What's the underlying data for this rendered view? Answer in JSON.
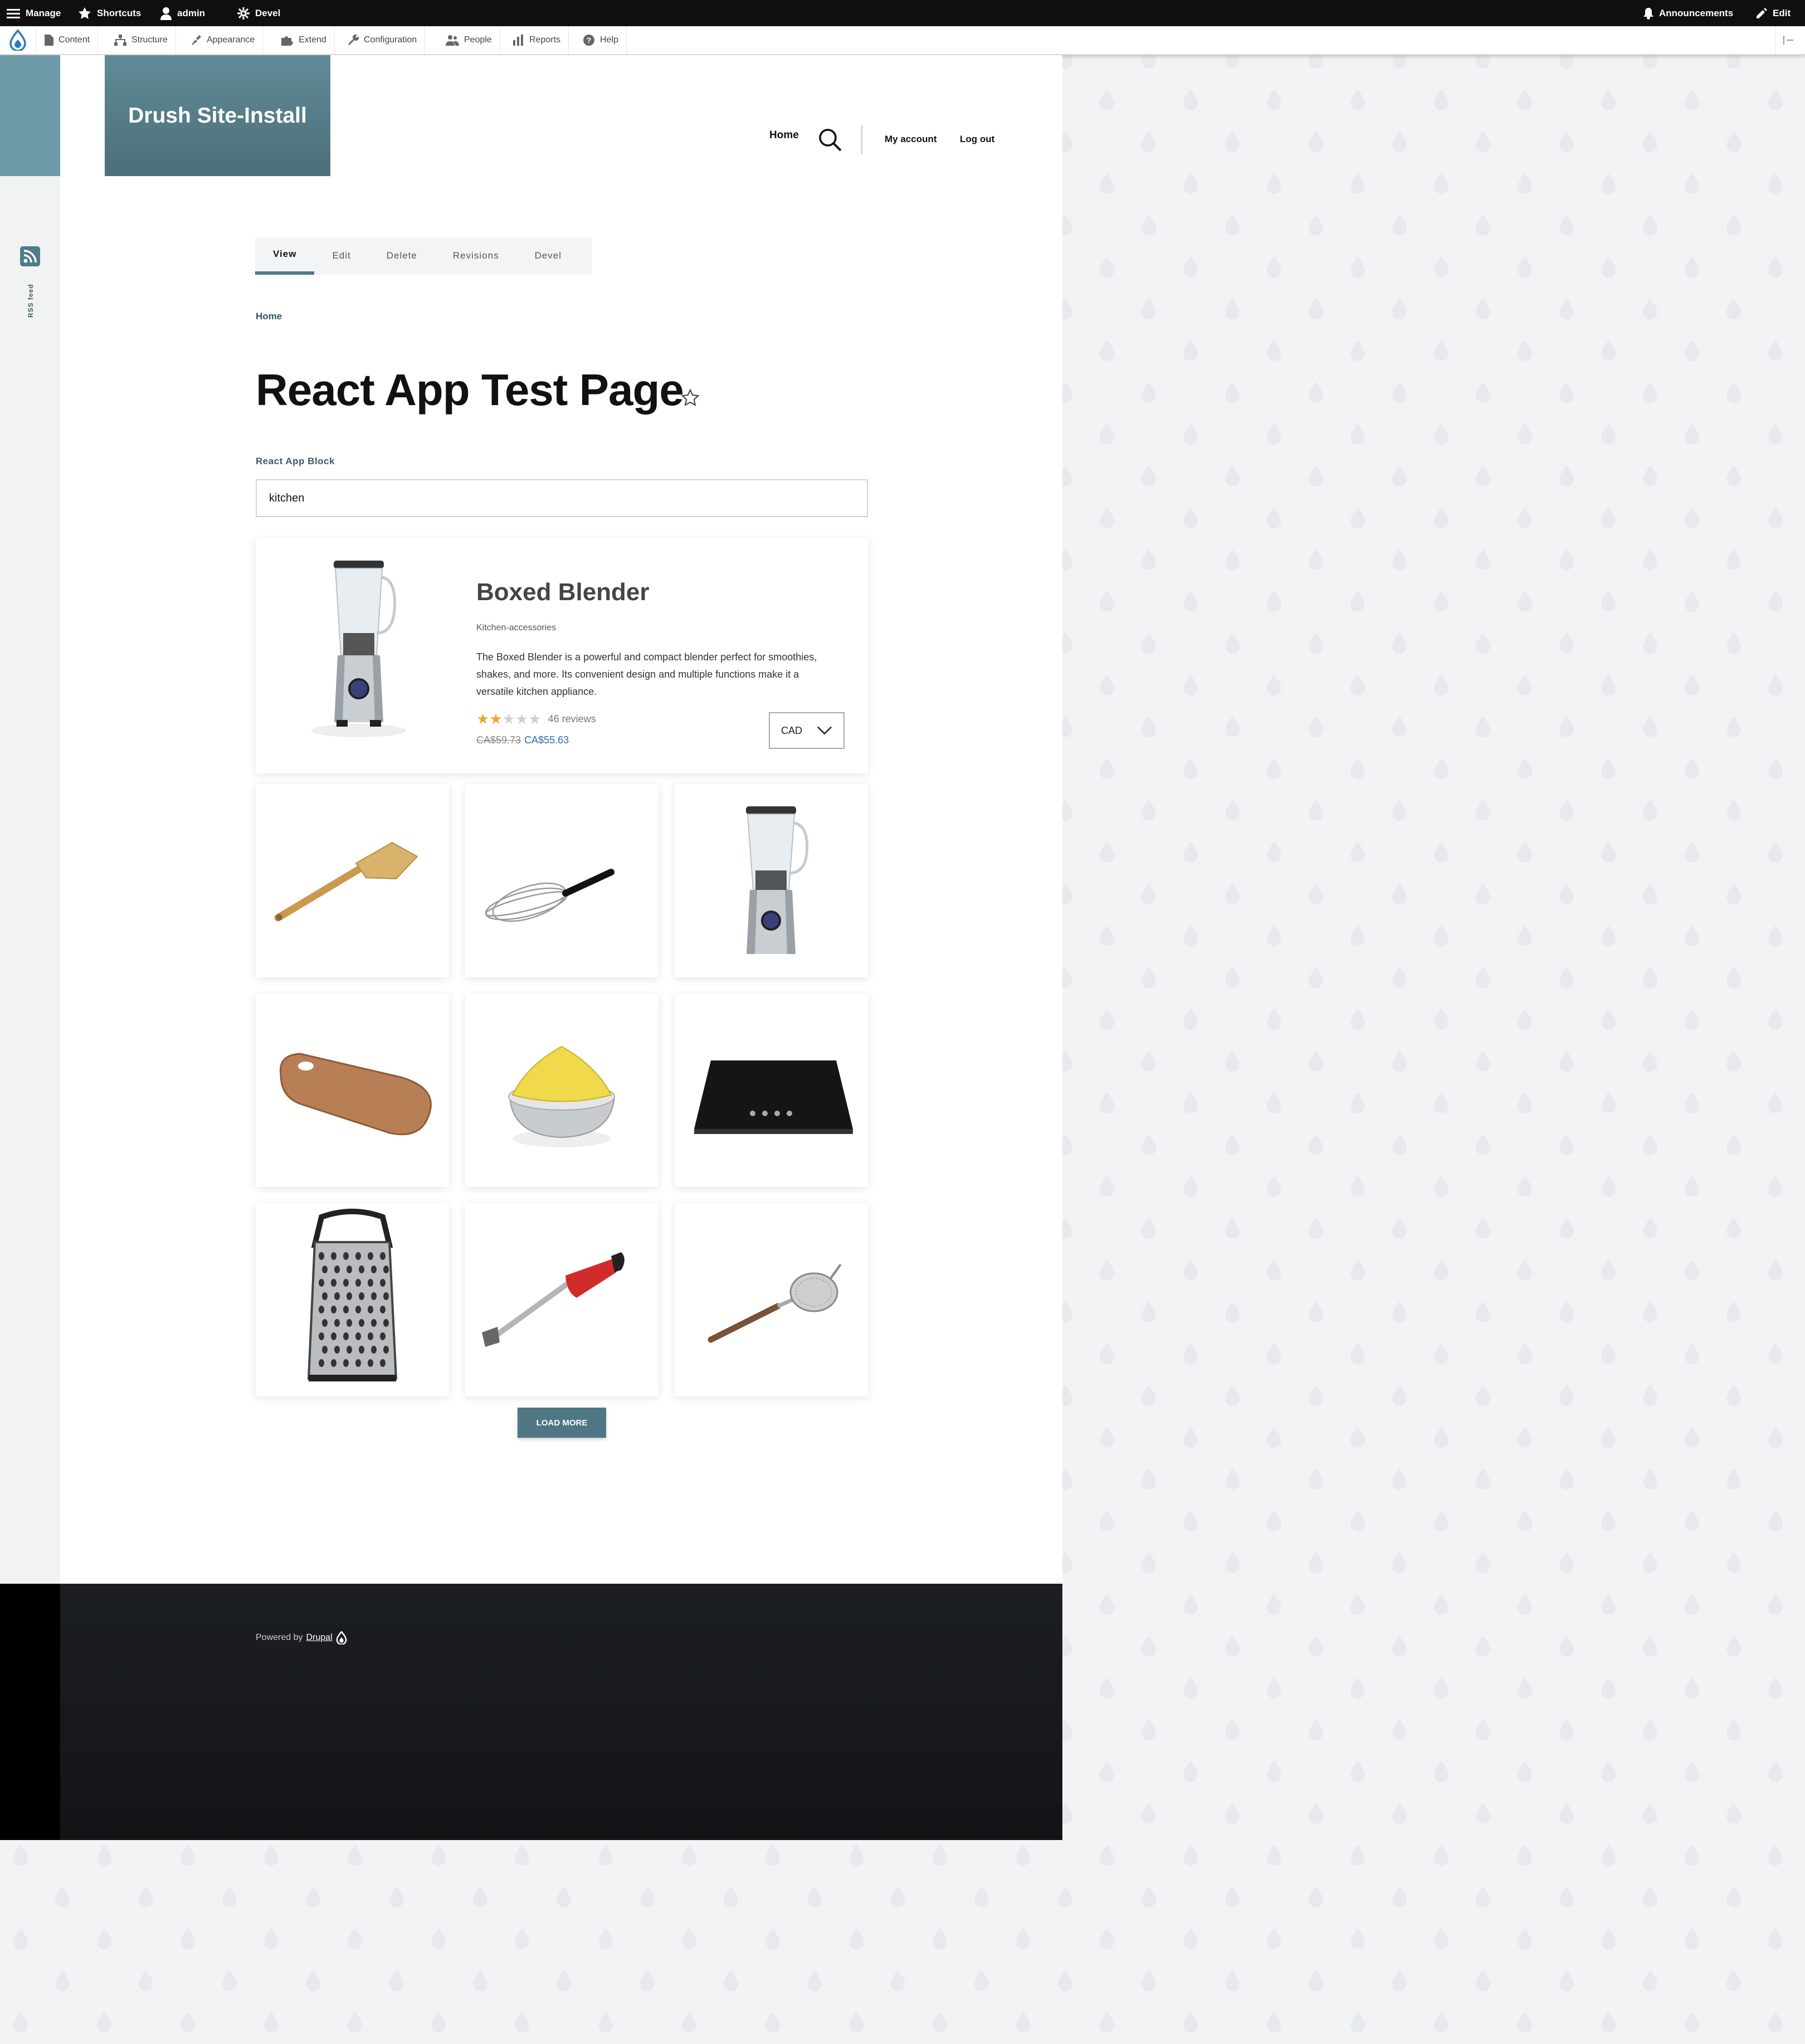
{
  "toolbar": {
    "manage": "Manage",
    "shortcuts": "Shortcuts",
    "user": "admin",
    "devel": "Devel",
    "announcements": "Announcements",
    "edit": "Edit"
  },
  "admin_menu": [
    "Content",
    "Structure",
    "Appearance",
    "Extend",
    "Configuration",
    "People",
    "Reports",
    "Help"
  ],
  "site": {
    "name": "Drush Site-Install",
    "nav_home": "Home",
    "my_account": "My account",
    "log_out": "Log out",
    "rss_label": "RSS feed"
  },
  "tabs": [
    "View",
    "Edit",
    "Delete",
    "Revisions",
    "Devel"
  ],
  "breadcrumb": "Home",
  "page_title": "React App Test Page",
  "block": {
    "label": "React App Block",
    "search_value": "kitchen"
  },
  "featured": {
    "title": "Boxed Blender",
    "category": "Kitchen-accessories",
    "description_lines": [
      "The Boxed Blender is a powerful and compact blender perfect for smoothies,",
      "shakes, and more. Its convenient design and multiple functions make it a",
      "versatile kitchen appliance."
    ],
    "rating": 2,
    "rating_max": 5,
    "reviews": "46 reviews",
    "old_price": "CA$59.73",
    "new_price": "CA$55.63",
    "currency": "CAD",
    "star_color": "#f0a32e",
    "price_color": "#2a6ab8"
  },
  "grid_items": [
    "spatula",
    "whisk",
    "blender",
    "cutting-board",
    "juicer",
    "cooktop",
    "grater",
    "hand-blender",
    "strainer"
  ],
  "load_more": "LOAD MORE",
  "footer": {
    "powered_by": "Powered by",
    "drupal": "Drupal"
  },
  "colors": {
    "accent": "#4d7c8b",
    "load_more_bg": "#4f7685"
  }
}
